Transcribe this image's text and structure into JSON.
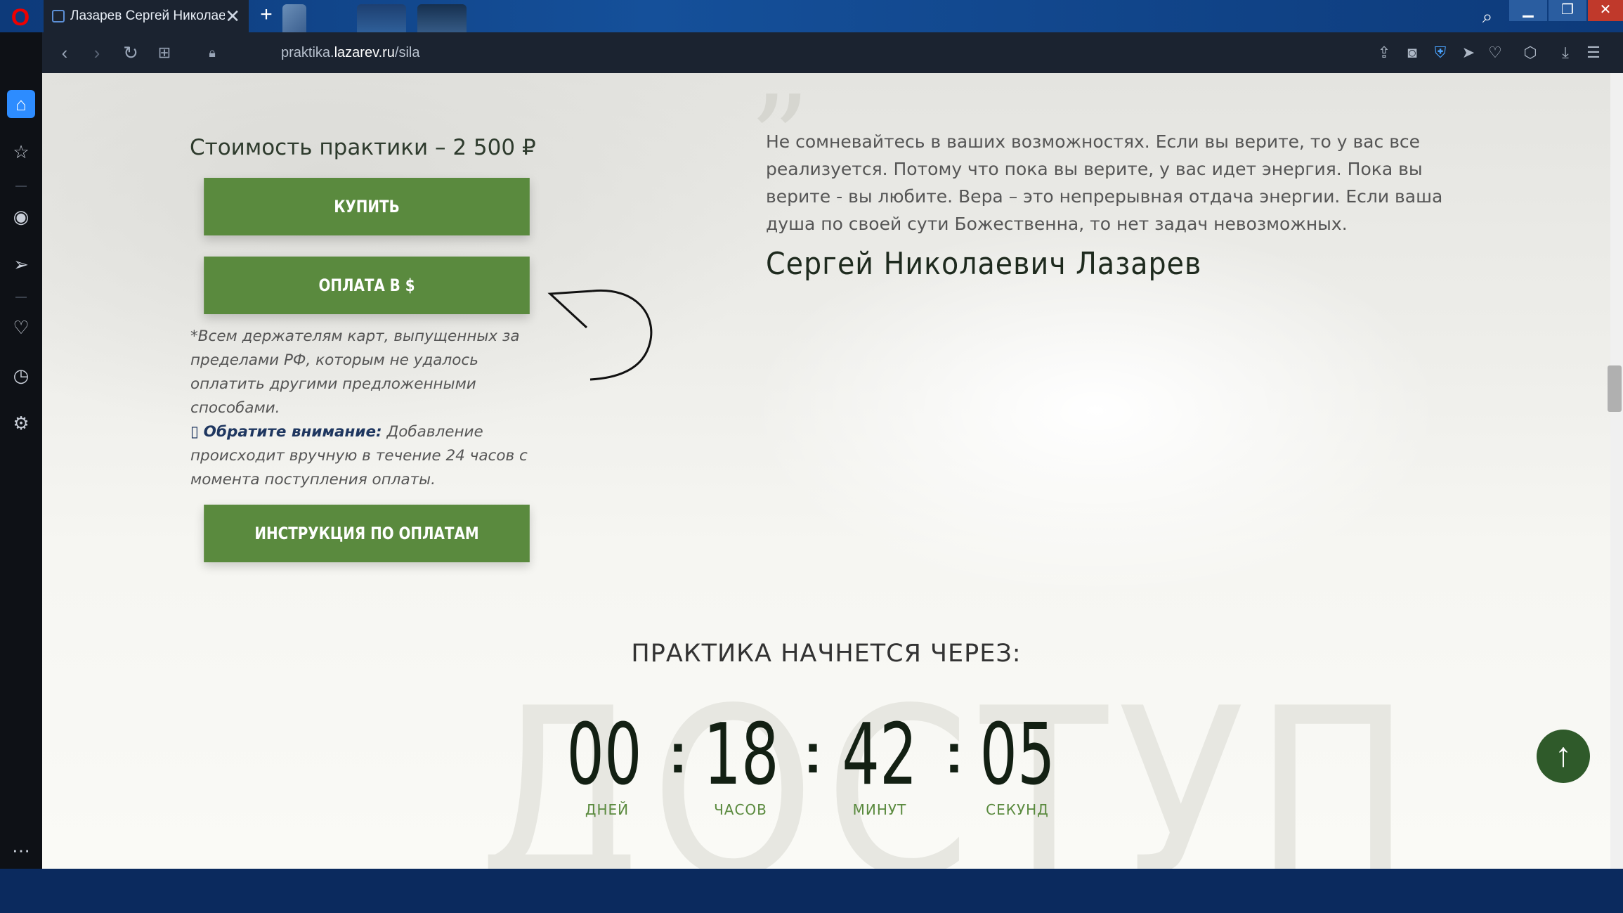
{
  "browser": {
    "tab_title": "Лазарев Сергей Николаевич",
    "tab_close": "✕",
    "new_tab": "+",
    "url_prefix": "praktika.",
    "url_domain": "lazarev.ru",
    "url_path": "/sila"
  },
  "sidebar_icons": [
    "home-icon",
    "bookmark-icon",
    "player-icon",
    "send-icon",
    "heart-icon",
    "history-icon",
    "settings-icon",
    "more-icon"
  ],
  "offer": {
    "price": "Стоимость практики – 2 500 ₽",
    "buy_button": "КУПИТЬ",
    "usd_button": "ОПЛАТА В $",
    "note_1": "*Всем держателям карт, выпущенных за пределами РФ, которым не удалось оплатить другими предложенными способами.",
    "note_attention_bold": "Обратите внимание:",
    "note_2": " Добавление происходит вручную в течение 24 часов с момента поступления оплаты.",
    "instruction_button": "ИНСТРУКЦИЯ ПО ОПЛАТАМ"
  },
  "quote": {
    "mark": "”",
    "text": "Не сомневайтесь в ваших возможностях. Если вы верите, то у вас все реализуется. Потому что пока вы верите, у вас идет энергия. Пока вы верите - вы любите. Вера – это непрерывная отдача энергии. Если ваша душа по своей сути Божественна, то нет задач невозможных.",
    "author": "Сергей Николаевич Лазарев"
  },
  "countdown": {
    "title": "ПРАКТИКА НАЧНЕТСЯ ЧЕРЕЗ:",
    "background_word": "ДОСТУП",
    "days": "00",
    "hours": "18",
    "minutes": "42",
    "seconds": "05",
    "separator": ":",
    "days_label": "ДНЕЙ",
    "hours_label": "ЧАСОВ",
    "minutes_label": "МИНУТ",
    "seconds_label": "СЕКУНД"
  },
  "colors": {
    "button_green": "#5a8a3e",
    "title_bar": "#0d3a7a",
    "back_to_top": "#2f5a2a"
  }
}
